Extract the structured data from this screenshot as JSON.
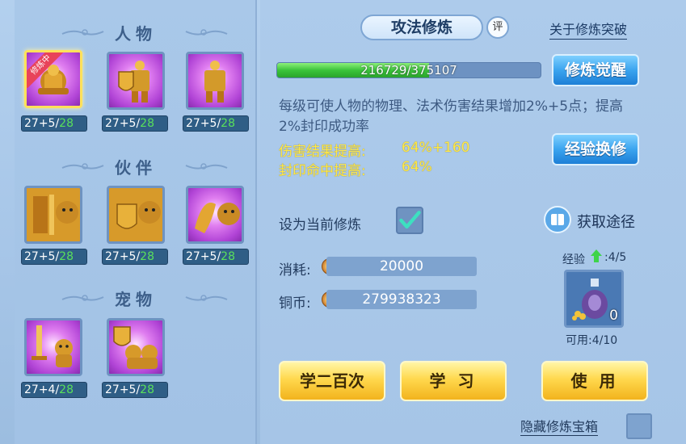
{
  "sections": {
    "character": "人物",
    "partner": "伙伴",
    "pet": "宠物"
  },
  "slots": {
    "character": [
      {
        "level_base": "27+5/",
        "level_max": "28",
        "status_ribbon": "修炼中"
      },
      {
        "level_base": "27+5/",
        "level_max": "28"
      },
      {
        "level_base": "27+5/",
        "level_max": "28"
      }
    ],
    "partner": [
      {
        "level_base": "27+5/",
        "level_max": "28"
      },
      {
        "level_base": "27+5/",
        "level_max": "28"
      },
      {
        "level_base": "27+5/",
        "level_max": "28"
      }
    ],
    "pet": [
      {
        "level_base": "27+4/",
        "level_max": "28"
      },
      {
        "level_base": "27+5/",
        "level_max": "28"
      }
    ]
  },
  "header": {
    "title": "攻法修炼",
    "eval_label": "评",
    "breakthrough_link": "关于修炼突破"
  },
  "progress": {
    "text": "216729/375107",
    "current": 216729,
    "total": 375107
  },
  "buttons": {
    "awaken": "修炼觉醒",
    "exchange_exp": "经验换修",
    "learn_200": "学二百次",
    "learn": "学 习",
    "use": "使 用"
  },
  "description": "每级可使人物的物理、法术伤害结果增加2%+5点；提高2%封印成功率",
  "stats": [
    {
      "label": "伤害结果提高:",
      "value": "64%+160"
    },
    {
      "label": "封印命中提高:",
      "value": "64%"
    }
  ],
  "set_current": {
    "label": "设为当前修炼",
    "checked": true
  },
  "acquire_link": "获取途径",
  "consume": {
    "label": "消耗:",
    "value": "20000"
  },
  "copper": {
    "label": "铜币:",
    "value": "279938323"
  },
  "exp_item": {
    "exp_label": "经验",
    "exp_value": ":4/5",
    "count": "0",
    "usable": "可用:4/10"
  },
  "hidden_chest": "隐藏修炼宝箱",
  "colors": {
    "accent_blue": "#3aa4ef",
    "button_yellow": "#ffd84d",
    "stat_yellow": "#ffe94a",
    "progress_green": "#3bc43a",
    "level_max_green": "#59e05b"
  }
}
